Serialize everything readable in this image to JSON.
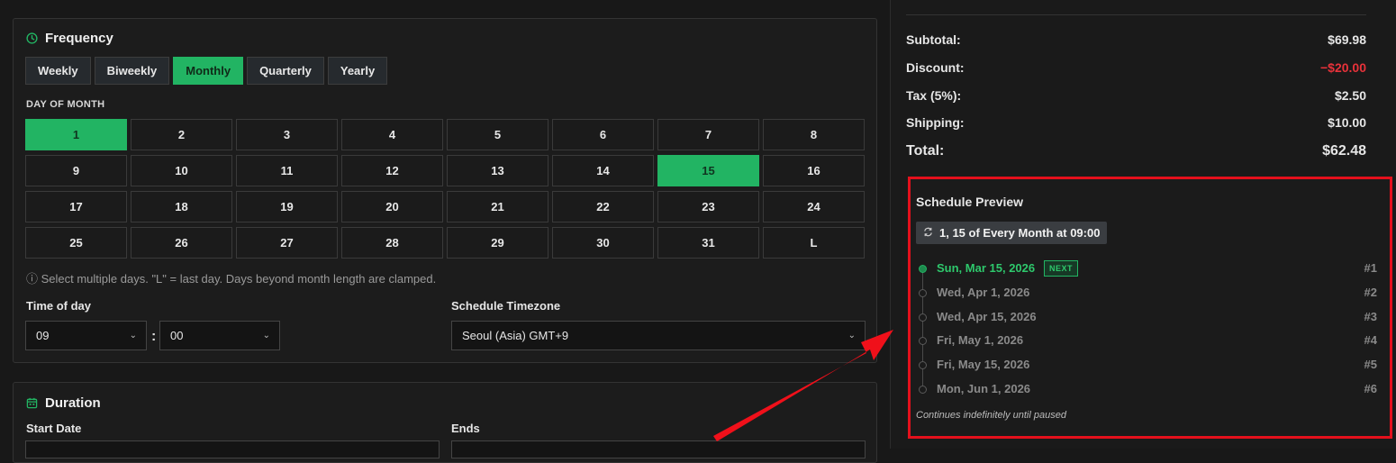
{
  "frequency": {
    "title": "Frequency",
    "options": [
      "Weekly",
      "Biweekly",
      "Monthly",
      "Quarterly",
      "Yearly"
    ],
    "selected": "Monthly",
    "day_of_month_label": "DAY OF MONTH",
    "days": [
      "1",
      "2",
      "3",
      "4",
      "5",
      "6",
      "7",
      "8",
      "9",
      "10",
      "11",
      "12",
      "13",
      "14",
      "15",
      "16",
      "17",
      "18",
      "19",
      "20",
      "21",
      "22",
      "23",
      "24",
      "25",
      "26",
      "27",
      "28",
      "29",
      "30",
      "31",
      "L"
    ],
    "selected_days": [
      "1",
      "15"
    ],
    "hint": "ⓘ Select multiple days. \"L\" = last day. Days beyond month length are clamped.",
    "time_of_day_label": "Time of day",
    "hour_value": "09",
    "minute_value": "00",
    "colon": ":",
    "timezone_label": "Schedule Timezone",
    "timezone_value": "Seoul (Asia) GMT+9"
  },
  "duration": {
    "title": "Duration",
    "start_date_label": "Start Date",
    "ends_label": "Ends"
  },
  "summary": {
    "subtotal_label": "Subtotal:",
    "subtotal_value": "$69.98",
    "discount_label": "Discount:",
    "discount_value": "−$20.00",
    "tax_label": "Tax (5%):",
    "tax_value": "$2.50",
    "shipping_label": "Shipping:",
    "shipping_value": "$10.00",
    "total_label": "Total:",
    "total_value": "$62.48"
  },
  "schedule_preview": {
    "title": "Schedule Preview",
    "badge": "1, 15 of Every Month at 09:00",
    "next_tag": "NEXT",
    "occurrences": [
      {
        "date": "Sun, Mar 15, 2026",
        "num": "#1"
      },
      {
        "date": "Wed, Apr 1, 2026",
        "num": "#2"
      },
      {
        "date": "Wed, Apr 15, 2026",
        "num": "#3"
      },
      {
        "date": "Fri, May 1, 2026",
        "num": "#4"
      },
      {
        "date": "Fri, May 15, 2026",
        "num": "#5"
      },
      {
        "date": "Mon, Jun 1, 2026",
        "num": "#6"
      }
    ],
    "footnote": "Continues indefinitely until paused"
  },
  "colors": {
    "accent": "#22b463",
    "highlight_border": "#e4101c",
    "discount_red": "#e8323a"
  },
  "icons": {
    "frequency": "clock-icon",
    "duration": "calendar-icon",
    "badge": "repeat-icon"
  }
}
